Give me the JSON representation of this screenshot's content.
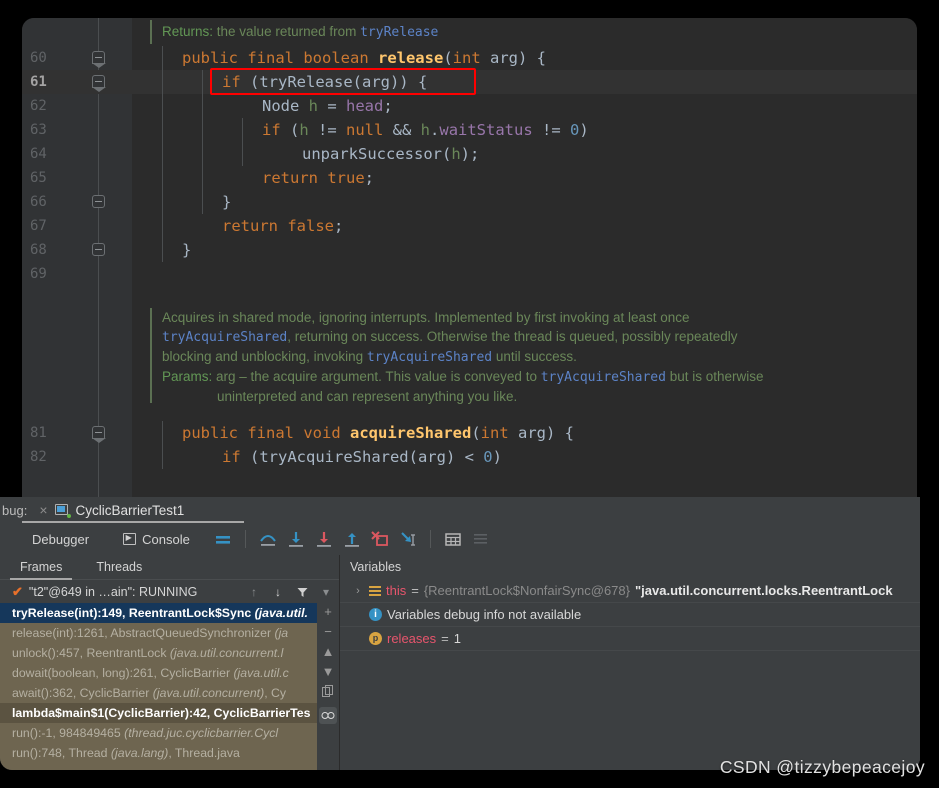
{
  "editor": {
    "javadoc_top": {
      "label": "Returns:",
      "text": " the value returned from ",
      "code": "tryRelease"
    },
    "lines": [
      {
        "num": "60",
        "fold": "open",
        "indent": 1,
        "highlight": false,
        "tokens": [
          {
            "t": "public ",
            "c": "kw"
          },
          {
            "t": "final ",
            "c": "kw"
          },
          {
            "t": "boolean ",
            "c": "kw"
          },
          {
            "t": "release",
            "c": "mname"
          },
          {
            "t": "(",
            "c": "plain"
          },
          {
            "t": "int",
            "c": "kw"
          },
          {
            "t": " arg",
            "c": "plain"
          },
          {
            "t": ") {",
            "c": "plain"
          }
        ]
      },
      {
        "num": "61",
        "fold": "open",
        "indent": 2,
        "highlight": true,
        "tokens": [
          {
            "t": "if ",
            "c": "kw"
          },
          {
            "t": "(tryRelease(arg)) {",
            "c": "plain"
          }
        ]
      },
      {
        "num": "62",
        "fold": "",
        "indent": 3,
        "highlight": false,
        "tokens": [
          {
            "t": "Node ",
            "c": "plain"
          },
          {
            "t": "h",
            "c": "grn"
          },
          {
            "t": " = ",
            "c": "plain"
          },
          {
            "t": "head",
            "c": "fld"
          },
          {
            "t": ";",
            "c": "plain"
          }
        ]
      },
      {
        "num": "63",
        "fold": "",
        "indent": 3,
        "highlight": false,
        "tokens": [
          {
            "t": "if ",
            "c": "kw"
          },
          {
            "t": "(",
            "c": "plain"
          },
          {
            "t": "h",
            "c": "grn"
          },
          {
            "t": " != ",
            "c": "plain"
          },
          {
            "t": "null",
            "c": "kw"
          },
          {
            "t": " && ",
            "c": "plain"
          },
          {
            "t": "h",
            "c": "grn"
          },
          {
            "t": ".",
            "c": "plain"
          },
          {
            "t": "waitStatus",
            "c": "fld"
          },
          {
            "t": " != ",
            "c": "plain"
          },
          {
            "t": "0",
            "c": "num"
          },
          {
            "t": ")",
            "c": "plain"
          }
        ]
      },
      {
        "num": "64",
        "fold": "",
        "indent": 4,
        "highlight": false,
        "tokens": [
          {
            "t": "unparkSuccessor(",
            "c": "plain"
          },
          {
            "t": "h",
            "c": "grn"
          },
          {
            "t": ");",
            "c": "plain"
          }
        ]
      },
      {
        "num": "65",
        "fold": "",
        "indent": 3,
        "highlight": false,
        "tokens": [
          {
            "t": "return ",
            "c": "kw"
          },
          {
            "t": "true",
            "c": "kw"
          },
          {
            "t": ";",
            "c": "plain"
          }
        ]
      },
      {
        "num": "66",
        "fold": "close",
        "indent": 2,
        "highlight": false,
        "tokens": [
          {
            "t": "}",
            "c": "plain"
          }
        ]
      },
      {
        "num": "67",
        "fold": "",
        "indent": 2,
        "highlight": false,
        "tokens": [
          {
            "t": "return ",
            "c": "kw"
          },
          {
            "t": "false",
            "c": "kw"
          },
          {
            "t": ";",
            "c": "plain"
          }
        ]
      },
      {
        "num": "68",
        "fold": "close",
        "indent": 1,
        "highlight": false,
        "tokens": [
          {
            "t": "}",
            "c": "plain"
          }
        ]
      },
      {
        "num": "69",
        "fold": "",
        "indent": 0,
        "highlight": false,
        "tokens": []
      }
    ],
    "javadoc_block": [
      "Acquires in shared mode, ignoring interrupts. Implemented by first invoking at least once",
      "tryAcquireShared, returning on success. Otherwise the thread is queued, possibly repeatedly",
      "blocking and unblocking, invoking tryAcquireShared until success.",
      "Params: arg – the acquire argument. This value is conveyed to tryAcquireShared but is otherwise",
      "uninterpreted and can represent anything you like."
    ],
    "lines_tail": [
      {
        "num": "81",
        "fold": "open",
        "indent": 1,
        "highlight": false,
        "tokens": [
          {
            "t": "public ",
            "c": "kw"
          },
          {
            "t": "final ",
            "c": "kw"
          },
          {
            "t": "void ",
            "c": "kw"
          },
          {
            "t": "acquireShared",
            "c": "mname"
          },
          {
            "t": "(",
            "c": "plain"
          },
          {
            "t": "int",
            "c": "kw"
          },
          {
            "t": " arg",
            "c": "plain"
          },
          {
            "t": ") {",
            "c": "plain"
          }
        ]
      },
      {
        "num": "82",
        "fold": "",
        "indent": 2,
        "highlight": false,
        "tokens": [
          {
            "t": "if ",
            "c": "kw"
          },
          {
            "t": "(tryAcquireShared(arg) < ",
            "c": "plain"
          },
          {
            "t": "0",
            "c": "num"
          },
          {
            "t": ")",
            "c": "plain"
          }
        ]
      }
    ],
    "highlight_box_color": "#ff0000"
  },
  "debug": {
    "window_label": "bug:",
    "close_icon": "×",
    "config_name": "CyclicBarrierTest1",
    "tabs": [
      {
        "label": "Debugger",
        "active": true
      },
      {
        "label": "Console",
        "active": false
      }
    ],
    "toolbar_icons": [
      "mute-breakpoints-icon",
      "step-over-icon",
      "step-into-icon",
      "force-step-into-icon",
      "step-out-icon",
      "drop-frame-icon",
      "run-to-cursor-icon",
      "evaluate-expression-icon",
      "settings-icon"
    ],
    "frames": {
      "pane_tabs": [
        {
          "label": "Frames",
          "active": true
        },
        {
          "label": "Threads",
          "active": false
        }
      ],
      "thread_selector": {
        "check_icon": "✔",
        "label": "\"t2\"@649 in …ain\": RUNNING",
        "buttons": [
          "↑",
          "↓",
          "filter-icon",
          "▾"
        ]
      },
      "sidebar_buttons": [
        "+",
        "−",
        "▲",
        "▼",
        "copy-icon",
        "watches-icon"
      ],
      "rows": [
        {
          "text": "tryRelease(int):149, ReentrantLock$Sync ",
          "italic": "(java.util.",
          "state": "selected"
        },
        {
          "text": "release(int):1261, AbstractQueuedSynchronizer ",
          "italic": "(ja",
          "state": "normal"
        },
        {
          "text": "unlock():457, ReentrantLock ",
          "italic": "(java.util.concurrent.l",
          "state": "normal"
        },
        {
          "text": "dowait(boolean, long):261, CyclicBarrier ",
          "italic": "(java.util.c",
          "state": "normal"
        },
        {
          "text": "await():362, CyclicBarrier ",
          "italic": "(java.util.concurrent)",
          "tail": ", Cy",
          "state": "normal"
        },
        {
          "text": "lambda$main$1(CyclicBarrier):42, CyclicBarrierTes",
          "italic": "",
          "state": "selected2"
        },
        {
          "text": "run():-1, 984849465 ",
          "italic": "(thread.juc.cyclicbarrier.Cycl",
          "state": "normal"
        },
        {
          "text": "run():748, Thread ",
          "italic": "(java.lang)",
          "tail": ", Thread.java",
          "state": "normal"
        }
      ]
    },
    "variables": {
      "title": "Variables",
      "rows": [
        {
          "icon": "object-icon",
          "expander": "›",
          "name": "this",
          "eq": " = ",
          "ref": "{ReentrantLock$NonfairSync@678}",
          "value": "\"java.util.concurrent.locks.ReentrantLock"
        },
        {
          "icon": "info-icon",
          "expander": "",
          "message": "Variables debug info not available"
        },
        {
          "icon": "primitive-icon",
          "expander": "",
          "name": "releases",
          "eq": " = ",
          "value": "1"
        }
      ]
    }
  },
  "watermark": "CSDN @tizzybepeacejoy",
  "colors": {
    "editor_bg": "#2b2b2b",
    "gutter_bg": "#313335",
    "panel_bg": "#3c3f41",
    "frames_bg": "#6e6550",
    "selection": "#15375b",
    "accent_red": "#ff0000",
    "keyword": "#cc7832",
    "method": "#ffc66d",
    "field": "#9876aa",
    "number": "#6897bb",
    "comment": "#629755"
  }
}
